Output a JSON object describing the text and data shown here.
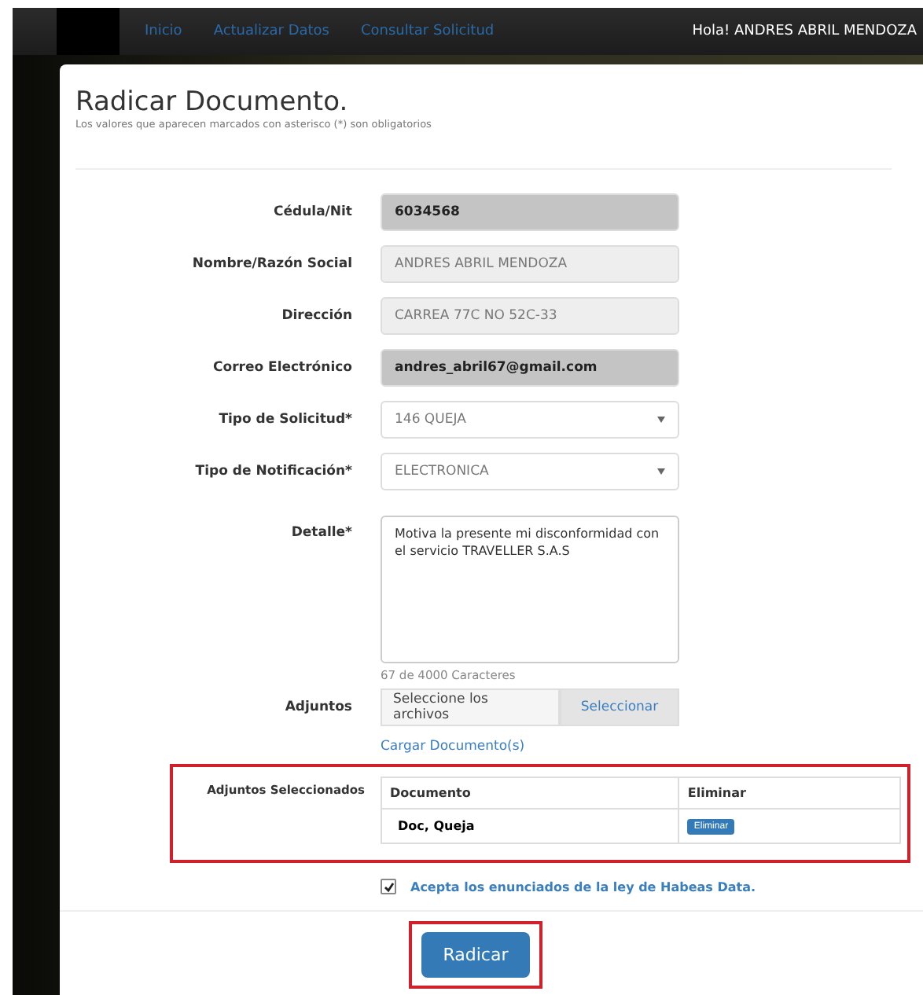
{
  "nav": {
    "links": [
      {
        "label": "Inicio"
      },
      {
        "label": "Actualizar Datos"
      },
      {
        "label": "Consultar Solicitud"
      }
    ],
    "greeting": "Hola! ANDRES ABRIL MENDOZA"
  },
  "form": {
    "title": "Radicar Documento.",
    "subtitle": "Los valores que aparecen marcados con asterisco (*) son obligatorios",
    "fields": [
      {
        "label": "Cédula/Nit",
        "kind": "locked",
        "value": "6034568"
      },
      {
        "label": "Nombre/Razón Social",
        "kind": "readonly",
        "value": "ANDRES ABRIL MENDOZA"
      },
      {
        "label": "Dirección",
        "kind": "readonly",
        "value": "CARREA 77C NO 52C-33"
      },
      {
        "label": "Correo Electrónico",
        "kind": "locked",
        "value": "andres_abril67@gmail.com"
      },
      {
        "label": "Tipo de Solicitud*",
        "kind": "select",
        "value": "146 QUEJA"
      },
      {
        "label": "Tipo de Notificación*",
        "kind": "select",
        "value": "ELECTRONICA"
      }
    ],
    "detail": {
      "label": "Detalle*",
      "value": "Motiva la presente mi disconformidad con el servicio TRAVELLER S.A.S",
      "counter": "67 de 4000 Caracteres"
    },
    "attachments": {
      "label": "Adjuntos",
      "placeholder": "Seleccione los archivos",
      "button": "Seleccionar",
      "upload_link": "Cargar Documento(s)"
    },
    "selected": {
      "label": "Adjuntos Seleccionados",
      "columns": [
        "Documento",
        "Eliminar"
      ],
      "rows": [
        {
          "document": "Doc, Queja",
          "action": "Eliminar"
        }
      ]
    },
    "habeas": {
      "checked": true,
      "label": "Acepta los enunciados de la ley de Habeas Data."
    },
    "submit": "Radicar"
  }
}
